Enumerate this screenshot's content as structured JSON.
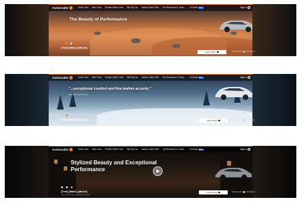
{
  "nav": {
    "logo_text": "Autotrader",
    "items": [
      "Used Cars",
      "New Cars",
      "Private Seller Cars",
      "Sell My Car",
      "Instant Cash Offer",
      "Car Research & Tools ⌄",
      "AI Mode"
    ],
    "new_badge": "Beta",
    "sign_in": "Sign In"
  },
  "banners": [
    {
      "headline": "The Beauty of Performance",
      "vehicle": "[Year] [Make] [Model]",
      "cta": "Learn More",
      "sponsor": "Sponsored by",
      "sponsor_brand": "Lucid Motors",
      "active_dot": 0
    },
    {
      "headline": "\"...exceptional comfort and fine leather accents.\"",
      "subheadline": "Autotrader 2024 Review",
      "vehicle": "[Year] [Make] [Model]",
      "disclaimer": "Selected content is independently created by Autotrader",
      "cta": "Learn More",
      "sponsor": "Sponsored by",
      "sponsor_brand": "Lucid Motors",
      "active_dot": 1
    },
    {
      "headline": "Stylized Beauty and Exceptional Performance",
      "vehicle": "[Year] [Make] [Model]",
      "disclaimer": "Professional images, visit dealer. Disclaimer",
      "cta": "Learn More",
      "sponsor": "Sponsored by",
      "sponsor_brand": "Lucid Motors",
      "active_dot": 2
    }
  ],
  "colors": {
    "accent": "#f58220",
    "nav_badge": "#1c6ce0"
  },
  "icons": {
    "cta": "external-link-icon",
    "user": "user-icon",
    "video": "play-icon"
  }
}
